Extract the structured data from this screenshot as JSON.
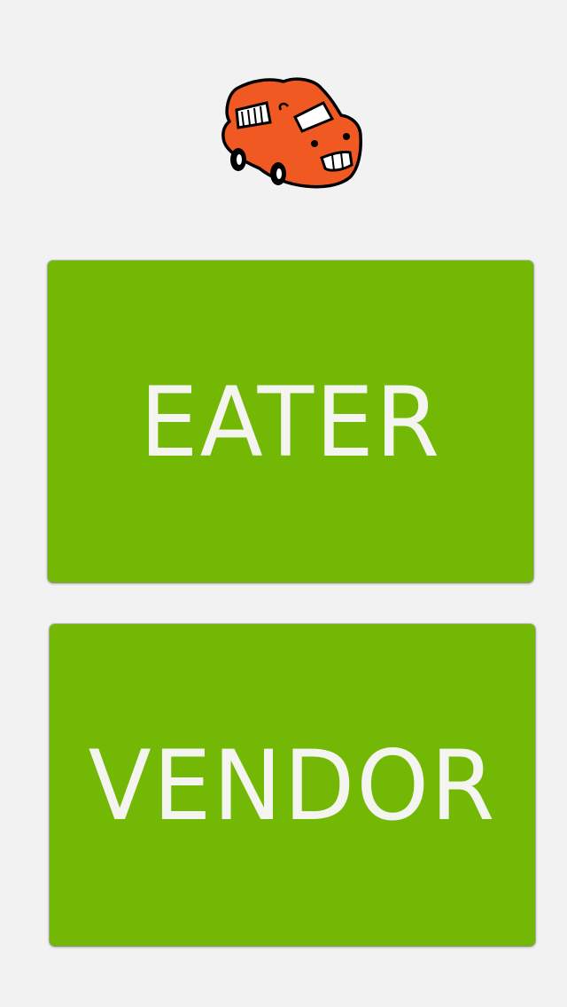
{
  "logo": {
    "icon": "food-truck-icon",
    "primary_color": "#f05a22"
  },
  "buttons": {
    "eater_label": "EATER",
    "vendor_label": "VENDOR",
    "color": "#74b806"
  }
}
